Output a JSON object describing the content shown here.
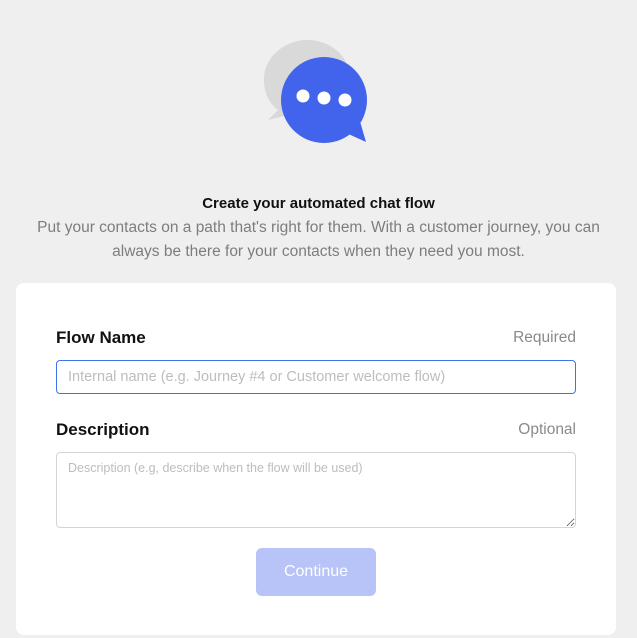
{
  "hero": {
    "icon": "chat-bubbles-icon",
    "accent_color": "#4264ec",
    "back_bubble_color": "#d9d9d9",
    "title": "Create your automated chat flow",
    "subtitle": "Put your contacts on a path that's right for them. With a customer journey, you can always be there for your contacts when they need you most."
  },
  "form": {
    "flow_name": {
      "label": "Flow Name",
      "hint": "Required",
      "placeholder": "Internal name (e.g. Journey #4 or Customer welcome flow)",
      "value": ""
    },
    "description": {
      "label": "Description",
      "hint": "Optional",
      "placeholder": "Description (e.g, describe when the flow will be used)",
      "value": ""
    },
    "continue_label": "Continue",
    "continue_color": "#b8c3f7"
  }
}
